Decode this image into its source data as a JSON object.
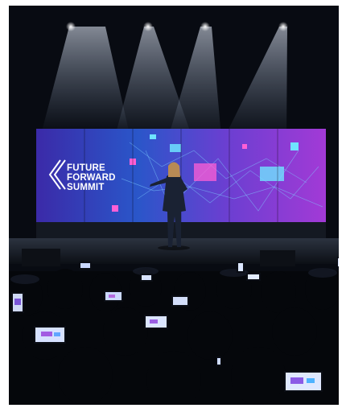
{
  "screen_text": {
    "line1": "FUTURE",
    "line2": "FORWARD",
    "line3": "SUMMIT"
  },
  "colors": {
    "background": "#07090f",
    "screen_purple": "#5b2fc7",
    "screen_magenta": "#b23bd9",
    "screen_cyan": "#2fd6ff",
    "accent_pink": "#ff4fd8",
    "phone_glow": "#e9f1ff"
  }
}
